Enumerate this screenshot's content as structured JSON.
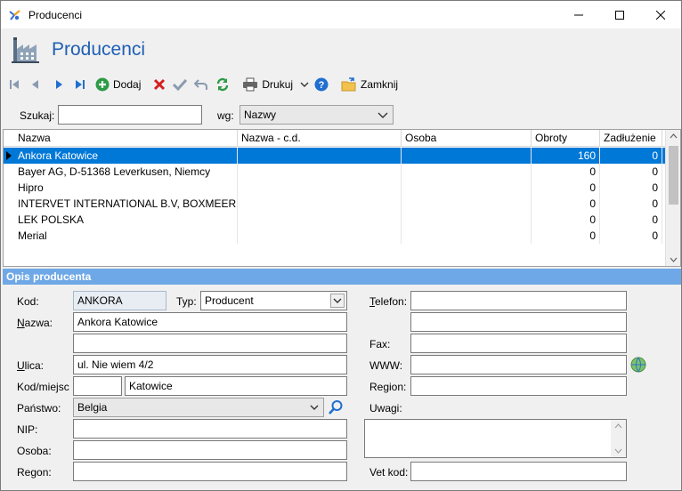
{
  "window": {
    "title": "Producenci",
    "minimize": "—",
    "maximize": "☐",
    "close": "✕"
  },
  "header": {
    "title": "Producenci"
  },
  "toolbar": {
    "add_label": "Dodaj",
    "print_label": "Drukuj",
    "close_label": "Zamknij"
  },
  "search": {
    "label": "Szukaj:",
    "value": "",
    "by_label": "wg:",
    "by_value": "Nazwy"
  },
  "grid": {
    "columns": [
      "Nazwa",
      "Nazwa - c.d.",
      "Osoba",
      "Obroty",
      "Zadłużenie"
    ],
    "rows": [
      {
        "name": "Ankora Katowice",
        "name2": "",
        "person": "",
        "turnover": "160",
        "debt": "0",
        "selected": true
      },
      {
        "name": "Bayer AG, D-51368 Leverkusen, Niemcy",
        "name2": "",
        "person": "",
        "turnover": "0",
        "debt": "0"
      },
      {
        "name": "Hipro",
        "name2": "",
        "person": "",
        "turnover": "0",
        "debt": "0"
      },
      {
        "name": "INTERVET INTERNATIONAL B.V, BOXMEER",
        "name2": "",
        "person": "",
        "turnover": "0",
        "debt": "0"
      },
      {
        "name": "LEK POLSKA",
        "name2": "",
        "person": "",
        "turnover": "0",
        "debt": "0"
      },
      {
        "name": "Merial",
        "name2": "",
        "person": "",
        "turnover": "0",
        "debt": "0"
      }
    ]
  },
  "section": {
    "title": "Opis producenta"
  },
  "form": {
    "kod_label": "Kod:",
    "kod_value": "ANKORA",
    "typ_label": "Typ:",
    "typ_value": "Producent",
    "nazwa_label": "Nazwa:",
    "nazwa_value": "Ankora Katowice",
    "nazwa2_value": "",
    "ulica_label": "Ulica:",
    "ulica_value": "ul. Nie wiem 4/2",
    "kodmiejsc_label": "Kod/miejsc",
    "kodpocztowy_value": "",
    "miasto_value": "Katowice",
    "panstwo_label": "Państwo:",
    "panstwo_value": "Belgia",
    "nip_label": "NIP:",
    "nip_value": "",
    "osoba_label": "Osoba:",
    "osoba_value": "",
    "regon_label": "Regon:",
    "regon_value": "",
    "telefon_label": "Telefon:",
    "telefon_value": "",
    "telefon2_value": "",
    "fax_label": "Fax:",
    "fax_value": "",
    "www_label": "WWW:",
    "www_value": "",
    "region_label": "Region:",
    "region_value": "",
    "uwagi_label": "Uwagi:",
    "uwagi_value": "",
    "vetkod_label": "Vet kod:",
    "vetkod_value": ""
  }
}
